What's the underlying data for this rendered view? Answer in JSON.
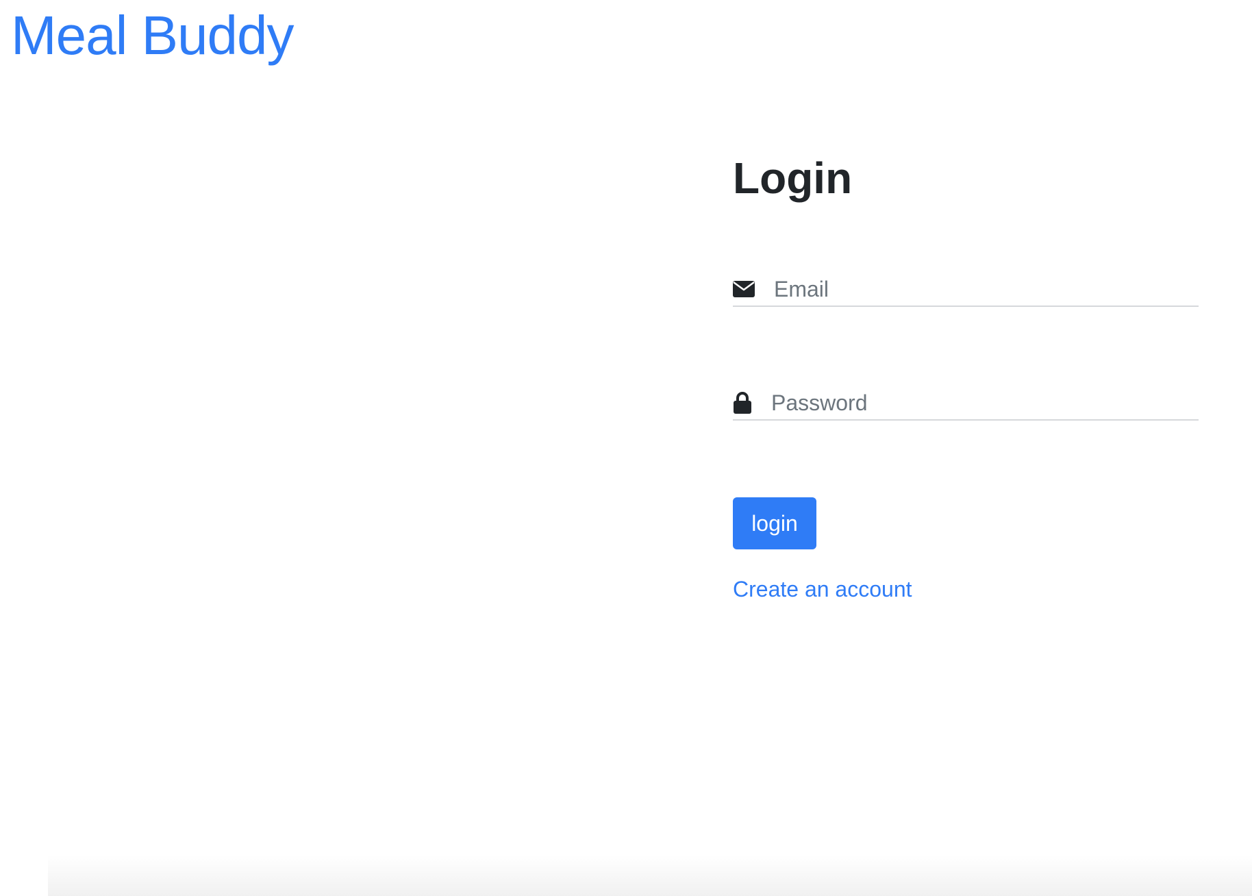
{
  "header": {
    "brand": "Meal Buddy"
  },
  "login": {
    "title": "Login",
    "email": {
      "placeholder": "Email",
      "value": "",
      "icon": "envelope-icon"
    },
    "password": {
      "placeholder": "Password",
      "value": "",
      "icon": "lock-icon"
    },
    "submit_label": "login",
    "create_account_label": "Create an account"
  },
  "colors": {
    "accent": "#2f7cf6",
    "text_dark": "#212529",
    "placeholder": "#6c757d",
    "divider": "#d6d8db"
  }
}
